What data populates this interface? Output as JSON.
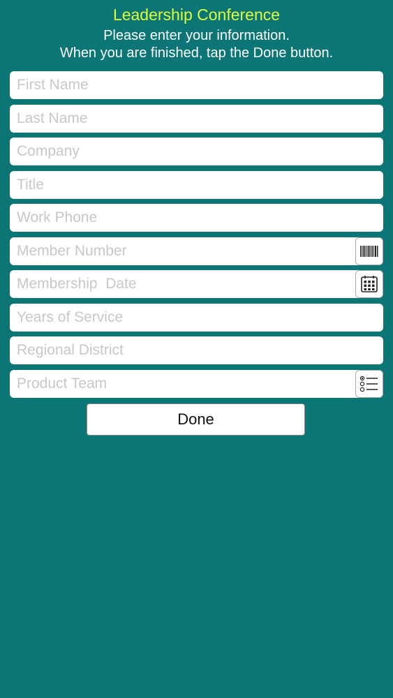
{
  "header": {
    "title": "Leadership Conference",
    "subtitle_line1": "Please enter your information.",
    "subtitle_line2": "When you are finished, tap the Done button."
  },
  "form": {
    "fields": [
      {
        "placeholder": "First Name",
        "value": ""
      },
      {
        "placeholder": "Last Name",
        "value": ""
      },
      {
        "placeholder": "Company",
        "value": ""
      },
      {
        "placeholder": "Title",
        "value": ""
      },
      {
        "placeholder": "Work Phone",
        "value": ""
      },
      {
        "placeholder": "Member Number",
        "value": "",
        "icon": "barcode-icon"
      },
      {
        "placeholder": "Membership  Date",
        "value": "",
        "icon": "calendar-icon"
      },
      {
        "placeholder": "Years of Service",
        "value": ""
      },
      {
        "placeholder": "Regional District",
        "value": ""
      },
      {
        "placeholder": "Product Team",
        "value": "",
        "icon": "list-options-icon"
      }
    ]
  },
  "done_button": {
    "label": "Done"
  },
  "colors": {
    "background": "#0b7675",
    "title": "#dcff3a",
    "text": "#ffffff",
    "placeholder": "#c7c7cc"
  }
}
